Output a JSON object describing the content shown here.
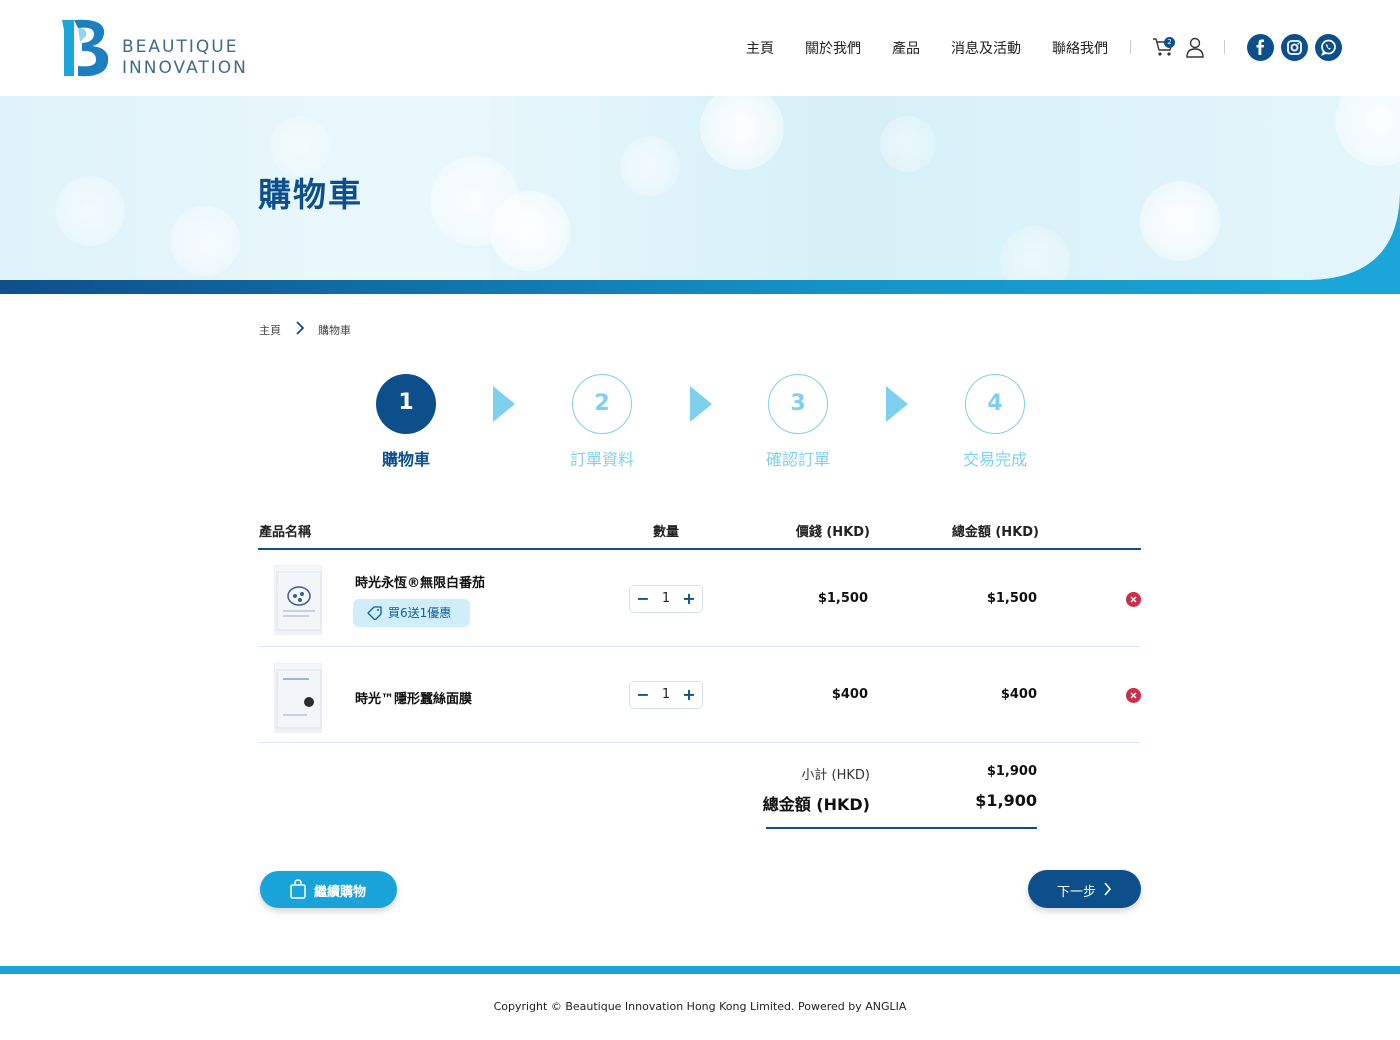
{
  "brand": {
    "line1": "BEAUTIQUE",
    "line2": "INNOVATION"
  },
  "nav": [
    "主頁",
    "關於我們",
    "產品",
    "消息及活動",
    "聯絡我們"
  ],
  "cart_count": "2",
  "banner": {
    "title": "購物車"
  },
  "breadcrumb": [
    "主頁",
    "購物車"
  ],
  "steps": [
    {
      "number": "1",
      "label": "購物車",
      "active": true
    },
    {
      "number": "2",
      "label": "訂單資料",
      "active": false
    },
    {
      "number": "3",
      "label": "確認訂單",
      "active": false
    },
    {
      "number": "4",
      "label": "交易完成",
      "active": false
    }
  ],
  "table": {
    "headers": {
      "product": "產品名稱",
      "qty": "數量",
      "price": "價錢 (HKD)",
      "total": "總金額 (HKD)"
    },
    "rows": [
      {
        "name": "時光永恆®無限白番茄",
        "promo": "買6送1優惠",
        "qty": "1",
        "price": "$1,500",
        "total": "$1,500"
      },
      {
        "name": "時光™隱形蠶絲面膜",
        "promo": "",
        "qty": "1",
        "price": "$400",
        "total": "$400"
      }
    ]
  },
  "summary": {
    "subtotal_label": "小計 (HKD)",
    "subtotal": "$1,900",
    "total_label": "總金額 (HKD)",
    "total": "$1,900"
  },
  "buttons": {
    "continue": "繼續購物",
    "next": "下一步"
  },
  "footer": {
    "copyright": "Copyright © Beautique Innovation Hong Kong Limited. Powered by ANGLIA"
  },
  "colors": {
    "primary": "#0d4f8b",
    "accent": "#1aa3d9",
    "light": "#7fd0ee",
    "remove": "#c92f4a"
  },
  "icons": [
    "cart-icon",
    "user-icon",
    "facebook-icon",
    "instagram-icon",
    "whatsapp-icon",
    "chevron-right-icon",
    "tag-icon",
    "shopping-bag-icon",
    "close-icon"
  ]
}
